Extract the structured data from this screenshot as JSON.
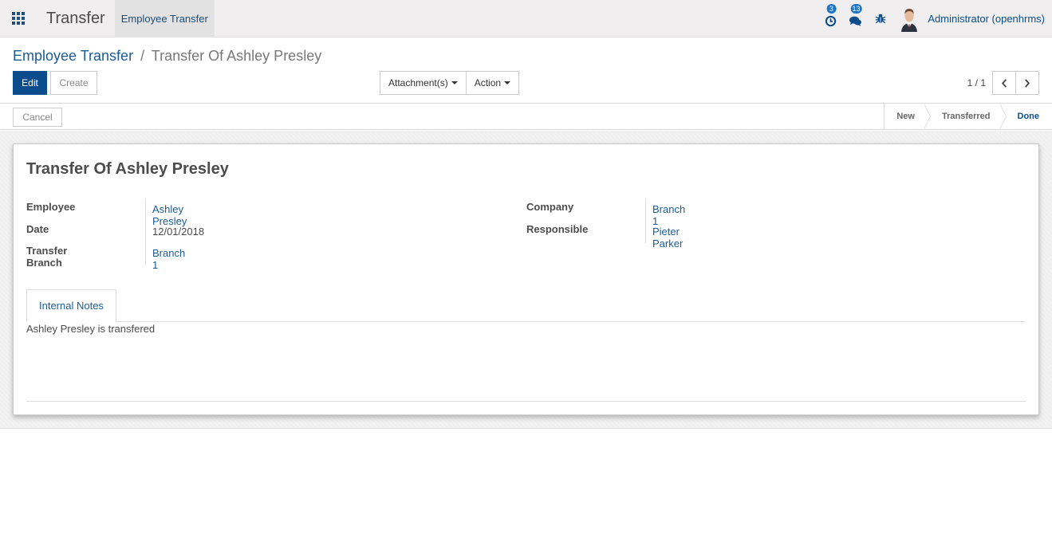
{
  "navbar": {
    "app_title": "Transfer",
    "menu_items": [
      {
        "label": "Employee Transfer"
      }
    ],
    "icons": {
      "activity": {
        "name": "clock-icon",
        "badge": "3"
      },
      "messages": {
        "name": "chat-icon",
        "badge": "13"
      },
      "debug": {
        "name": "bug-icon"
      }
    },
    "user_name": "Administrator (openhrms)"
  },
  "breadcrumb": {
    "parent": "Employee Transfer",
    "separator": "/",
    "current": "Transfer Of Ashley Presley"
  },
  "toolbar": {
    "edit_label": "Edit",
    "create_label": "Create",
    "attachments_label": "Attachment(s)",
    "action_label": "Action",
    "pager_value": "1 / 1"
  },
  "statusbar": {
    "cancel_label": "Cancel",
    "stages": [
      {
        "label": "New",
        "active": false
      },
      {
        "label": "Transferred",
        "active": false
      },
      {
        "label": "Done",
        "active": true
      }
    ]
  },
  "form": {
    "title": "Transfer Of Ashley Presley",
    "left_fields": [
      {
        "label": "Employee",
        "value": "Ashley Presley",
        "link": true
      },
      {
        "label": "Date",
        "value": "12/01/2018",
        "link": false
      },
      {
        "label": "Transfer Branch",
        "value": "Branch 1",
        "link": true
      }
    ],
    "right_fields": [
      {
        "label": "Company",
        "value": "Branch 1",
        "link": true
      },
      {
        "label": "Responsible",
        "value": "Pieter Parker",
        "link": true
      }
    ],
    "tabs": [
      {
        "label": "Internal Notes"
      }
    ],
    "notes": "Ashley Presley is transfered"
  },
  "colors": {
    "brand": "#0b4d8c",
    "link": "#1d5b93",
    "badge": "#1e74c6",
    "navbar_bg": "#f0eeee"
  }
}
